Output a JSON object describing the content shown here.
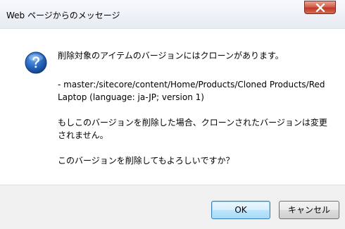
{
  "window": {
    "title": "Web ページからのメッセージ"
  },
  "dialog": {
    "icon": "question-icon",
    "line1": "削除対象のアイテムのバージョンにはクローンがあります。",
    "line2": "- master:/sitecore/content/Home/Products/Cloned Products/Red Laptop (language: ja-JP; version 1)",
    "line3": "もしこのバージョンを削除した場合、クローンされたバージョンは変更されません。",
    "line4": "このバージョンを削除してもよろしいですか？"
  },
  "buttons": {
    "ok_label": "OK",
    "cancel_label": "キャンセル"
  },
  "colors": {
    "close_button": "#c0392b",
    "icon_blue": "#1f5fb0",
    "ok_border": "#3c7fb1",
    "footer_bg": "#f0f0f0"
  }
}
